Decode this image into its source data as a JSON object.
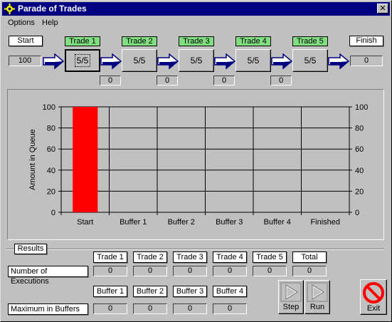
{
  "window": {
    "title": "Parade of Trades"
  },
  "menu": {
    "items": [
      "Options",
      "Help"
    ]
  },
  "pipeline": {
    "start_label": "Start",
    "start_value": "100",
    "finish_label": "Finish",
    "finish_value": "0",
    "trades": [
      {
        "label": "Trade 1",
        "value": "5/5",
        "active": true
      },
      {
        "label": "Trade 2",
        "value": "5/5",
        "active": false
      },
      {
        "label": "Trade 3",
        "value": "5/5",
        "active": false
      },
      {
        "label": "Trade 4",
        "value": "5/5",
        "active": false
      },
      {
        "label": "Trade 5",
        "value": "5/5",
        "active": false
      }
    ],
    "buffers": [
      "0",
      "0",
      "0",
      "0"
    ]
  },
  "chart_data": {
    "type": "bar",
    "categories": [
      "Start",
      "Buffer 1",
      "Buffer 2",
      "Buffer 3",
      "Buffer 4",
      "Finished"
    ],
    "values": [
      100,
      0,
      0,
      0,
      0,
      0
    ],
    "ylabel": "Amount in Queue",
    "xlabel": "",
    "ylim": [
      0,
      100
    ],
    "yticks": [
      "0",
      "20",
      "40",
      "60",
      "80",
      "100"
    ],
    "bar_color": "#ff0000",
    "grid": true,
    "secondary_y_axis": true
  },
  "results": {
    "group_label": "Results",
    "exec_row_label": "Number of Executions",
    "exec_headers": [
      "Trade 1",
      "Trade 2",
      "Trade 3",
      "Trade 4",
      "Trade 5",
      "Total"
    ],
    "exec_values": [
      "0",
      "0",
      "0",
      "0",
      "0",
      "0"
    ],
    "buffer_row_label": "Maximum in Buffers",
    "buffer_headers": [
      "Buffer 1",
      "Buffer 2",
      "Buffer 3",
      "Buffer 4"
    ],
    "buffer_values": [
      "0",
      "0",
      "0",
      "0"
    ],
    "step_label": "Step",
    "run_label": "Run",
    "exit_label": "Exit"
  }
}
